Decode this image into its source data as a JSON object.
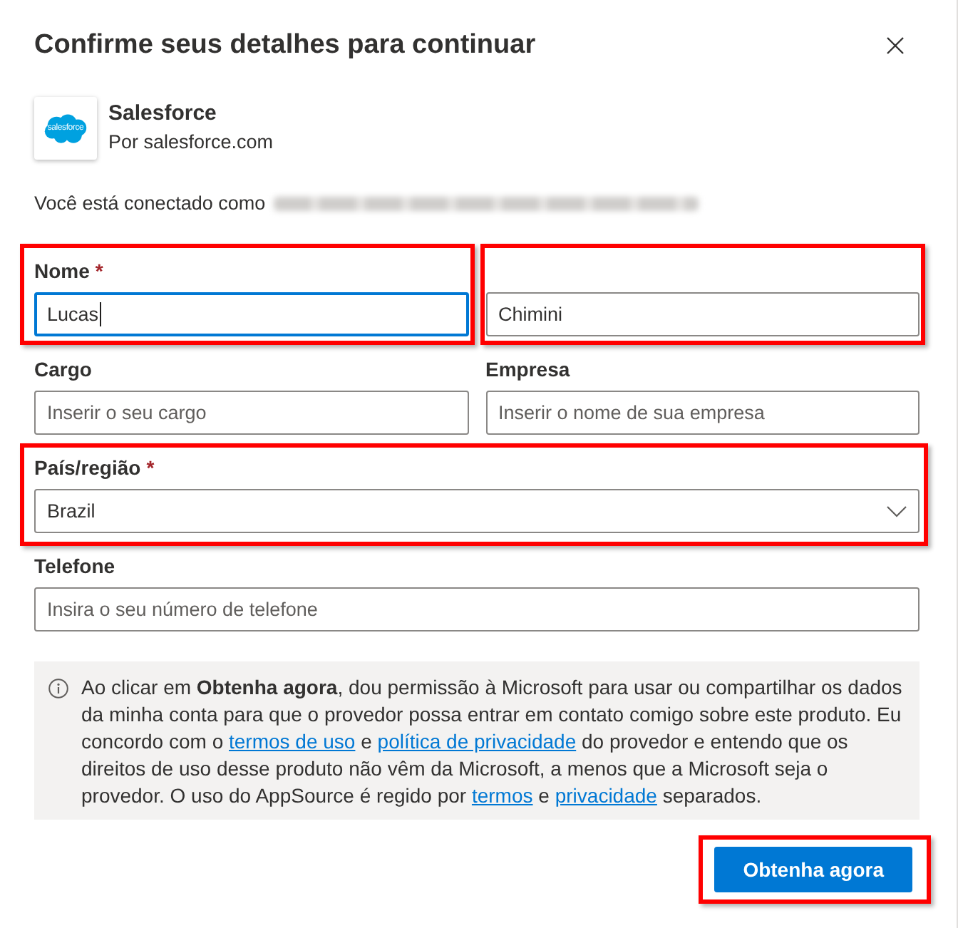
{
  "dialog": {
    "title": "Confirme seus detalhes para continuar"
  },
  "app": {
    "name": "Salesforce",
    "publisher": "Por salesforce.com",
    "logo_text": "salesforce"
  },
  "signed_in": {
    "label": "Você está conectado como",
    "account_redacted": true
  },
  "fields": [
    [
      {
        "kind": "text",
        "label": "Nome",
        "required_mark": "*",
        "value": "Lucas",
        "focused": true,
        "highlighted": true
      },
      {
        "kind": "text",
        "value": "Chimini",
        "focused": false,
        "highlighted": true
      }
    ],
    [
      {
        "kind": "text",
        "label": "Cargo",
        "placeholder": "Inserir o seu cargo",
        "focused": false,
        "highlighted": false
      },
      {
        "kind": "text",
        "label": "Empresa",
        "placeholder": "Inserir o nome de sua empresa",
        "focused": false,
        "highlighted": false
      }
    ],
    [
      {
        "kind": "select",
        "label": "País/região",
        "required_mark": "*",
        "value": "Brazil",
        "focused": false,
        "highlighted": true
      }
    ],
    [
      {
        "kind": "text",
        "label": "Telefone",
        "placeholder": "Insira o seu número de telefone",
        "focused": false,
        "highlighted": false
      }
    ]
  ],
  "consent": {
    "segments": [
      {
        "kind": "text",
        "text": "Ao clicar em **Obtenha agora**, dou permissão à Microsoft para usar ou compartilhar os dados da minha conta para que o provedor possa entrar em contato comigo sobre este produto. Eu concordo com o "
      },
      {
        "kind": "link",
        "text": "termos de uso"
      },
      {
        "kind": "text",
        "text": " e "
      },
      {
        "kind": "link",
        "text": "política de privacidade"
      },
      {
        "kind": "text",
        "text": " do provedor e entendo que os direitos de uso desse produto não vêm da Microsoft, a menos que a Microsoft seja o provedor. O uso do AppSource é regido por "
      },
      {
        "kind": "link",
        "text": "termos"
      },
      {
        "kind": "text",
        "text": " e "
      },
      {
        "kind": "link",
        "text": "privacidade"
      },
      {
        "kind": "text",
        "text": " separados."
      }
    ]
  },
  "primary_button": {
    "label": "Obtenha agora",
    "highlighted": true
  }
}
